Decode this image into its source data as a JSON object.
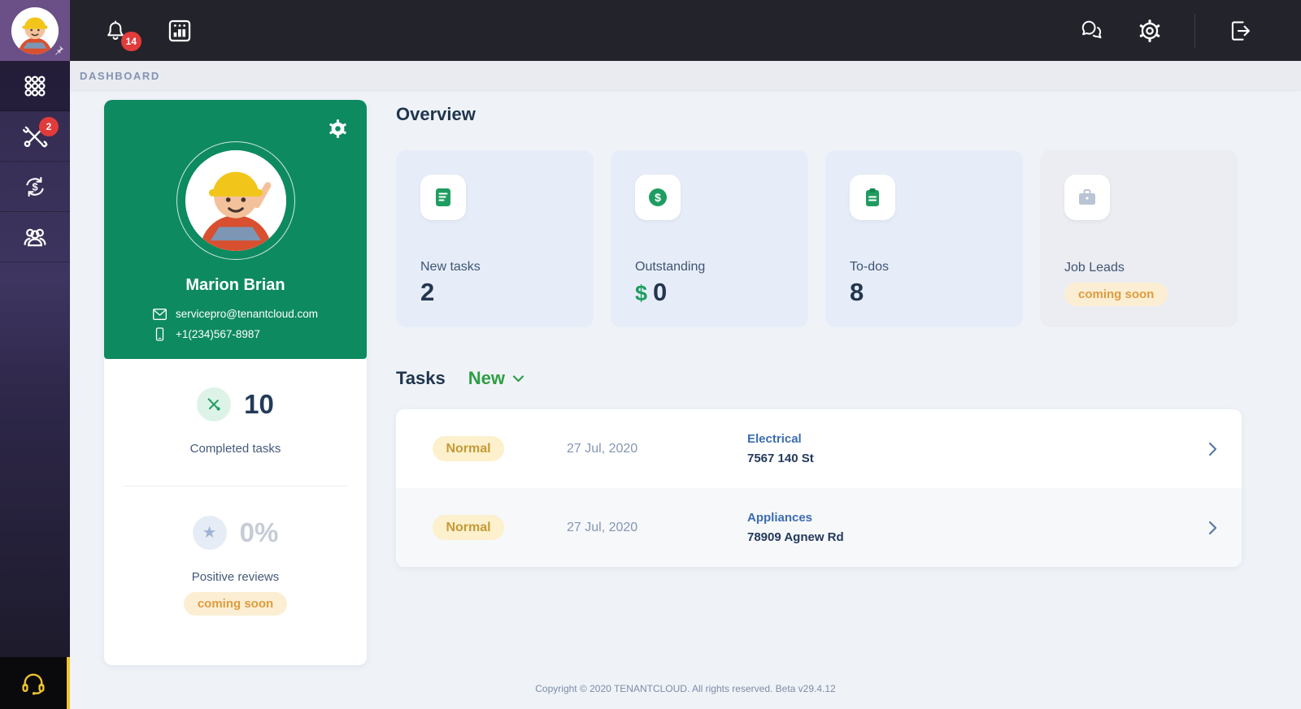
{
  "colors": {
    "topbar_bg": "#23242b",
    "sidebar_purple": "#3e3560",
    "avatar_purple": "#6b5087",
    "brand_green": "#0e8a61",
    "icon_green": "#1f9d61",
    "filter_green": "#2f9e44",
    "badge_red": "#e23b3b",
    "priority_pill_bg": "#fcf0cd",
    "priority_pill_text": "#c59a36",
    "coming_soon_bg": "#fbeed3",
    "coming_soon_text": "#df9c3e",
    "link_blue": "#3b6db1",
    "navy_text": "#233b58",
    "support_yellow": "#f0c330",
    "card_blue_bg": "#e7edf8"
  },
  "topbar": {
    "notifications_badge": "14",
    "icons": [
      "bell-icon",
      "calendar-icon",
      "chat-icon",
      "gear-icon",
      "logout-icon"
    ]
  },
  "sidebar": {
    "avatar": "bob-builder-avatar",
    "pin_icon": "pin-icon",
    "maintenance_badge": "2",
    "items": [
      {
        "name": "dashboard",
        "icon": "grid-dots-icon",
        "active": true
      },
      {
        "name": "maintenance",
        "icon": "crossed-tools-icon",
        "badge": "2"
      },
      {
        "name": "payments",
        "icon": "money-sync-icon"
      },
      {
        "name": "contacts",
        "icon": "people-icon"
      }
    ],
    "support_icon": "headset-icon"
  },
  "breadcrumb": {
    "label": "DASHBOARD"
  },
  "profile": {
    "name": "Marion Brian",
    "email": "servicepro@tenantcloud.com",
    "phone": "+1(234)567-8987",
    "completed": {
      "value": "10",
      "label": "Completed tasks"
    },
    "reviews": {
      "value": "0%",
      "label": "Positive reviews",
      "badge": "coming soon"
    }
  },
  "overview": {
    "title": "Overview",
    "cards": [
      {
        "label": "New tasks",
        "value": "2",
        "icon": "note-icon"
      },
      {
        "label": "Outstanding",
        "currency": "$",
        "value": "0",
        "icon": "dollar-circle-icon"
      },
      {
        "label": "To-dos",
        "value": "8",
        "icon": "clipboard-icon"
      },
      {
        "label": "Job Leads",
        "badge": "coming soon",
        "icon": "briefcase-icon"
      }
    ]
  },
  "tasks": {
    "title": "Tasks",
    "filter_label": "New",
    "rows": [
      {
        "priority": "Normal",
        "date": "27 Jul, 2020",
        "category": "Electrical",
        "address": "7567 140 St"
      },
      {
        "priority": "Normal",
        "date": "27 Jul, 2020",
        "category": "Appliances",
        "address": "78909 Agnew Rd"
      }
    ]
  },
  "footer": {
    "copyright": "Copyright © 2020 TENANTCLOUD. All rights reserved. Beta v29.4.12"
  }
}
